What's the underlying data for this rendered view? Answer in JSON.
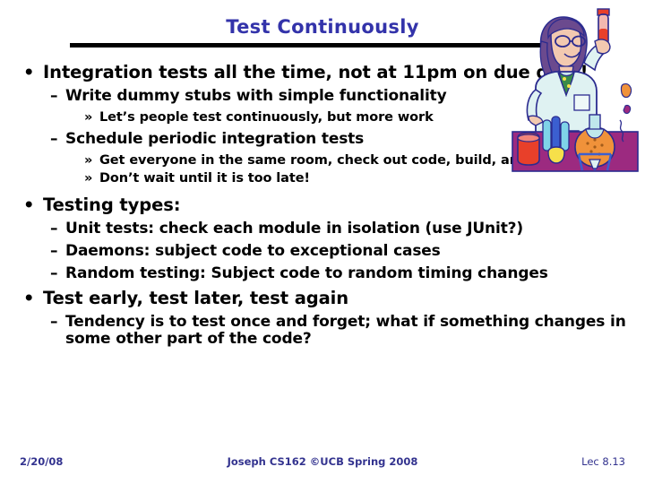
{
  "slide": {
    "title": "Test Continuously",
    "title_color": "#3333aa",
    "rule_color": "#000000",
    "background": "#ffffff"
  },
  "content": {
    "blocks": [
      {
        "level": 1,
        "marker": "•",
        "text": "Integration tests all the time, not at 11pm on due date!"
      },
      {
        "level": 2,
        "marker": "–",
        "text": "Write dummy stubs with simple functionality"
      },
      {
        "level": 3,
        "marker": "»",
        "text": "Let’s people test continuously, but more work"
      },
      {
        "level": 2,
        "marker": "–",
        "text": "Schedule periodic integration tests"
      },
      {
        "level": 3,
        "marker": "»",
        "text": "Get everyone in the same room, check out code, build, and test."
      },
      {
        "level": 3,
        "marker": "»",
        "text": "Don’t wait until it is too late!"
      },
      {
        "level": 1,
        "marker": "•",
        "text": "Testing types:"
      },
      {
        "level": 2,
        "marker": "–",
        "text": "Unit tests: check each module in isolation (use JUnit?)"
      },
      {
        "level": 2,
        "marker": "–",
        "text": "Daemons: subject code to exceptional cases"
      },
      {
        "level": 2,
        "marker": "–",
        "text": "Random testing: Subject code to random timing changes"
      },
      {
        "level": 1,
        "marker": "•",
        "text": "Test early, test later, test again"
      },
      {
        "level": 2,
        "marker": "–",
        "text": "Tendency is to test once and forget; what if something changes in some other part of the code?"
      }
    ]
  },
  "footer": {
    "date": "2/20/08",
    "center": "Joseph CS162 ©UCB Spring 2008",
    "lecture": "Lec 8.13",
    "color": "#33338f"
  },
  "clipart": {
    "name": "scientist-with-test-tube",
    "description": "Cartoon scientist in lab coat holding a test tube at a lab bench with beakers and flasks",
    "colors": {
      "coat": "#cde8ea",
      "skin": "#f2c9b0",
      "hair": "#6b4a8e",
      "table": "#9c2a80",
      "red_liquid": "#e8402a",
      "orange_flask": "#f0923a",
      "blue_flask": "#3b5fd0",
      "yellow_beaker": "#f6e04a",
      "green_tie": "#3a8a4a"
    }
  }
}
